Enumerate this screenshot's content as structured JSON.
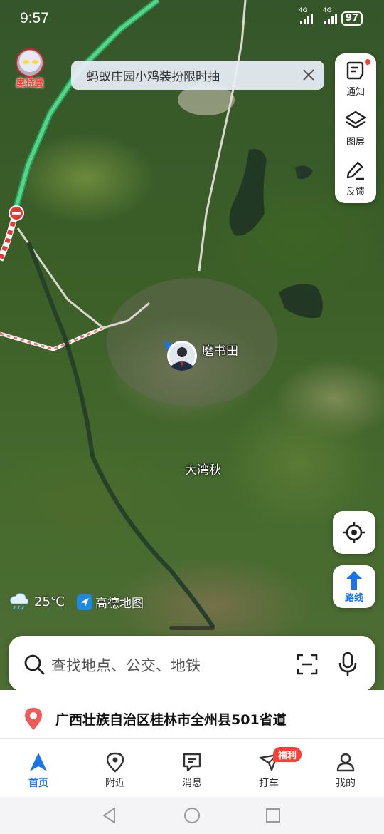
{
  "status_bar": {
    "time": "9:57",
    "network_1": "4G",
    "network_2": "4G",
    "battery": "97"
  },
  "ultraman": {
    "label": "奥特曼"
  },
  "promo": {
    "text": "蚂蚁庄园小鸡装扮限时抽"
  },
  "side_panel": [
    {
      "label": "通知",
      "icon": "notice-icon"
    },
    {
      "label": "图层",
      "icon": "layers-icon"
    },
    {
      "label": "反馈",
      "icon": "edit-icon"
    }
  ],
  "map_labels": {
    "village_1": "磨书田",
    "village_2": "大湾秋"
  },
  "route_button": {
    "label": "路线"
  },
  "weather": {
    "temp": "25℃"
  },
  "map_brand": {
    "name": "高德地图"
  },
  "search": {
    "placeholder": "查找地点、公交、地铁"
  },
  "location": {
    "address": "广西壮族自治区桂林市全州县501省道"
  },
  "nav": [
    {
      "label": "首页",
      "icon": "navigation-arrow-icon",
      "active": true
    },
    {
      "label": "附近",
      "icon": "location-pin-icon"
    },
    {
      "label": "消息",
      "icon": "message-icon"
    },
    {
      "label": "打车",
      "icon": "taxi-icon",
      "badge": "福利"
    },
    {
      "label": "我的",
      "icon": "person-icon"
    }
  ],
  "colors": {
    "accent": "#1a73e8",
    "badge": "#f44336",
    "highway": "#38c172"
  }
}
